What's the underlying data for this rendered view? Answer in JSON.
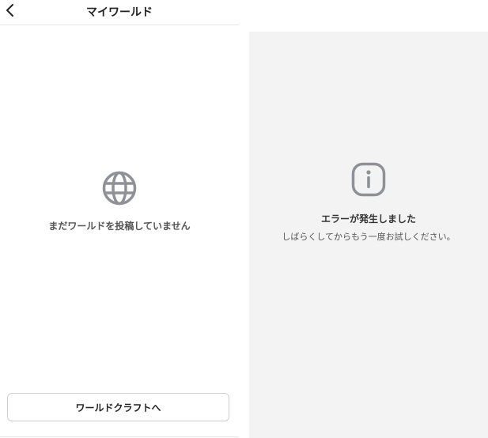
{
  "header": {
    "back_icon": "chevron-left-icon",
    "title": "マイワールド"
  },
  "empty_state": {
    "icon": "globe-icon",
    "message": "まだワールドを投稿していません"
  },
  "cta": {
    "label": "ワールドクラフトへ"
  },
  "error_state": {
    "icon": "info-icon",
    "title": "エラーが発生しました",
    "description": "しばらくしてからもう一度お試しください。"
  },
  "colors": {
    "icon_gray": "#8f9196",
    "panel_gray": "#f3f3f3",
    "divider": "#e6e6e6"
  }
}
